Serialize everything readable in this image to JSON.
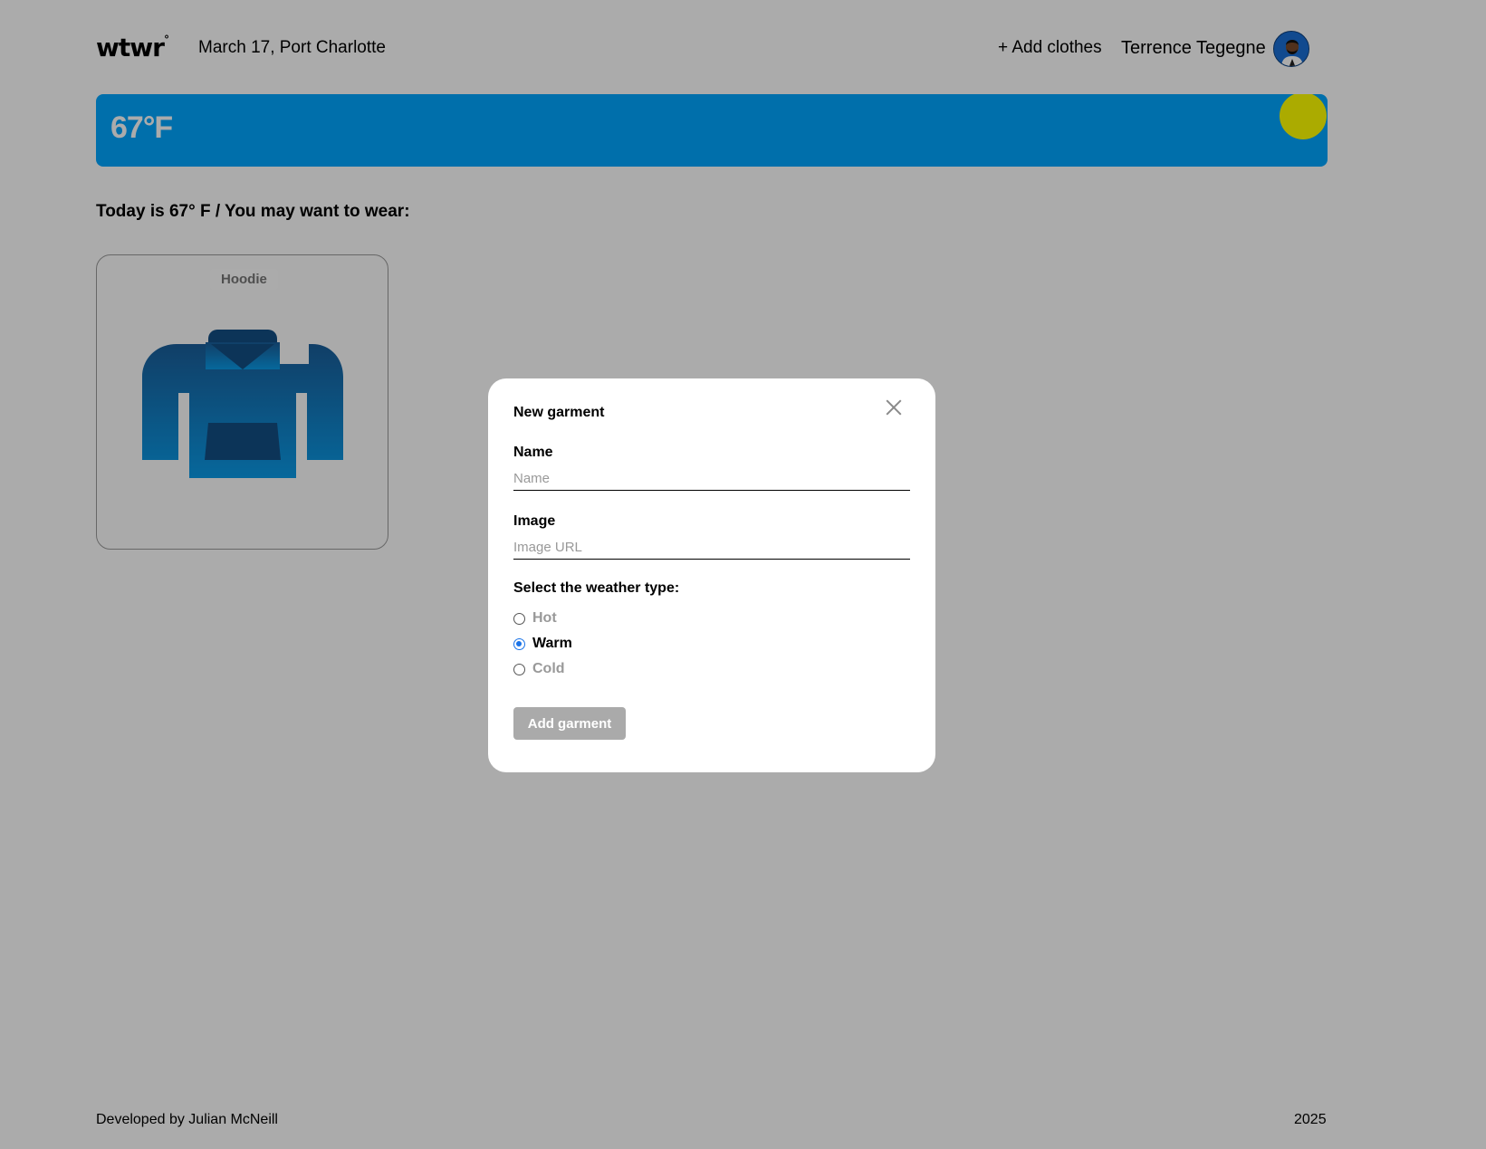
{
  "header": {
    "logo": "wtwr",
    "logo_degree": "°",
    "date_location": "March 17, Port Charlotte",
    "add_clothes": "+ Add clothes",
    "username": "Terrence Tegegne"
  },
  "weather": {
    "temperature": "67°F",
    "banner_color": "#00a6ff",
    "sun_color": "#ffff00"
  },
  "main": {
    "today_text": "Today is 67° F / You may want to wear:",
    "cards": [
      {
        "label": "Hoodie",
        "icon": "hoodie-icon"
      }
    ]
  },
  "modal": {
    "title": "New garment",
    "name_label": "Name",
    "name_placeholder": "Name",
    "name_value": "",
    "image_label": "Image",
    "image_placeholder": "Image URL",
    "image_value": "",
    "weather_label": "Select the weather type:",
    "options": [
      {
        "label": "Hot",
        "checked": false
      },
      {
        "label": "Warm",
        "checked": true
      },
      {
        "label": "Cold",
        "checked": false
      }
    ],
    "submit_label": "Add garment"
  },
  "footer": {
    "credit": "Developed by Julian McNeill",
    "year": "2025"
  }
}
